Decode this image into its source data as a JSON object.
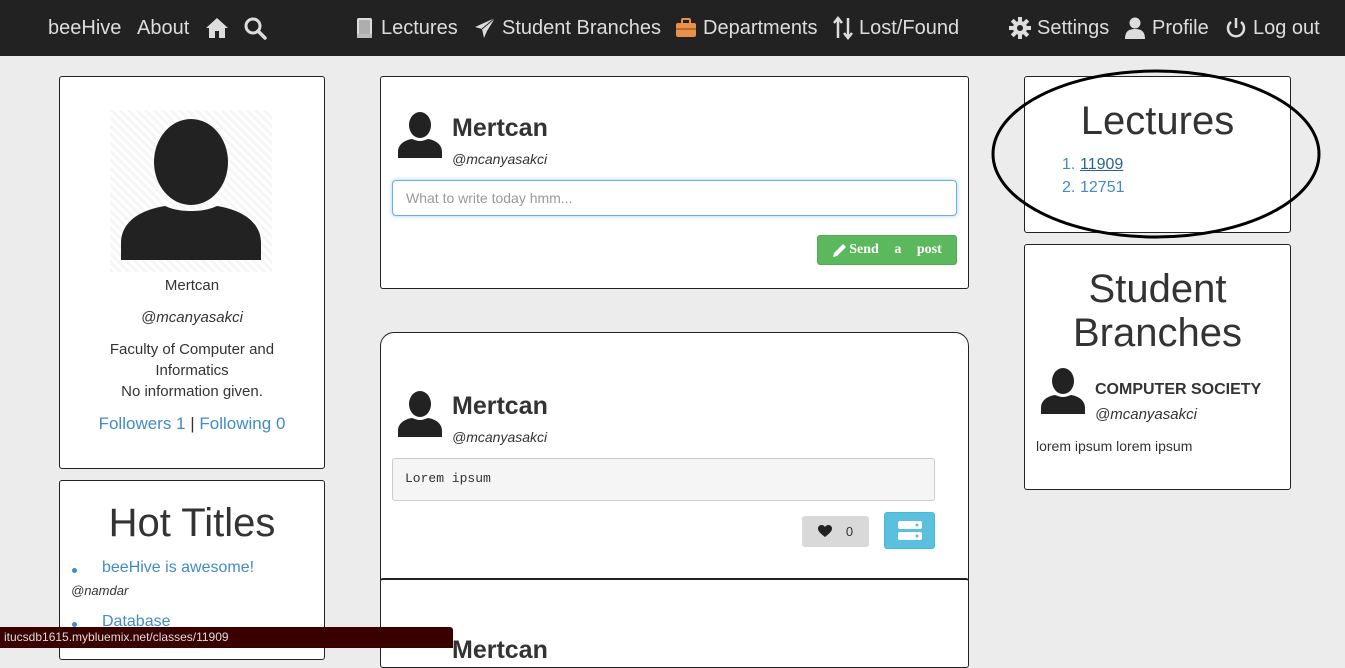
{
  "nav": {
    "brand": "beeHive",
    "about": "About",
    "lectures": "Lectures",
    "student_branches": "Student Branches",
    "departments": "Departments",
    "lost_found": "Lost/Found",
    "settings": "Settings",
    "profile": "Profile",
    "logout": "Log out"
  },
  "profile": {
    "name": "Mertcan",
    "handle": "@mcanyasakci",
    "faculty_line1": "Faculty of Computer and",
    "faculty_line2": "Informatics",
    "info": "No information given.",
    "followers": "Followers 1",
    "separator": "|",
    "following": "Following 0"
  },
  "hot_titles": {
    "title": "Hot Titles",
    "items": [
      {
        "title": "beeHive is awesome!",
        "author": "@namdar"
      },
      {
        "title": "Database",
        "author": ""
      }
    ]
  },
  "composer": {
    "name": "Mertcan",
    "handle": "@mcanyasakci",
    "placeholder": "What to write today hmm...",
    "send_label": "Send a post"
  },
  "post": {
    "name": "Mertcan",
    "handle": "@mcanyasakci",
    "content": "Lorem ipsum",
    "likes": "0"
  },
  "lectures_panel": {
    "title": "Lectures",
    "items": [
      {
        "num": "1.",
        "code": "11909"
      },
      {
        "num": "2.",
        "code": "12751"
      }
    ]
  },
  "branches_panel": {
    "title_line1": "Student",
    "title_line2": "Branches",
    "branch_name": "COMPUTER SOCIETY",
    "branch_handle": "@mcanyasakci",
    "description": "lorem ipsum lorem ipsum"
  },
  "status_url": "itucsdb1615.mybluemix.net/classes/11909",
  "colors": {
    "navbar": "#222222",
    "link": "#428bca",
    "send_button": "#5cb85c",
    "menu_button": "#5bc0de",
    "departments_icon": "#e8914a"
  },
  "icons": [
    "home-icon",
    "search-icon",
    "book-icon",
    "paper-plane-icon",
    "briefcase-icon",
    "sort-arrows-icon",
    "gear-icon",
    "user-icon",
    "power-icon",
    "pencil-icon",
    "heart-icon",
    "server-icon"
  ]
}
